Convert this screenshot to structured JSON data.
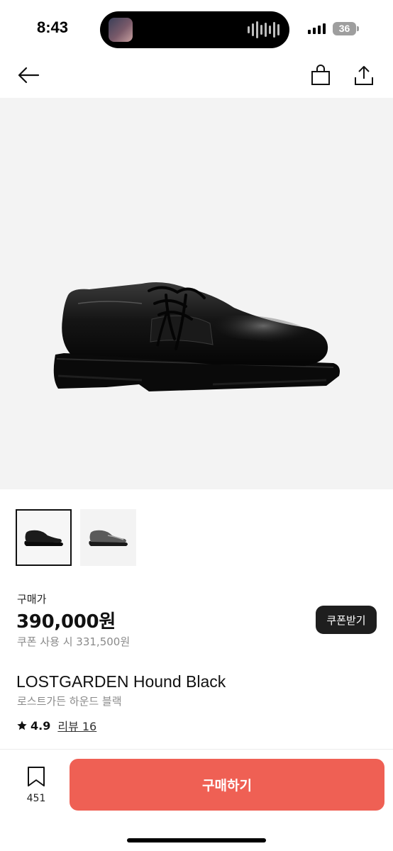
{
  "status_bar": {
    "time": "8:43",
    "battery": "36"
  },
  "icons": {
    "back": "back-arrow-icon",
    "bag": "shopping-bag-icon",
    "share": "share-icon",
    "wish": "bookmark-icon",
    "star": "star-icon"
  },
  "product": {
    "price_label": "구매가",
    "price": "390,000원",
    "coupon_price": "쿠폰 사용 시 331,500원",
    "coupon_button": "쿠폰받기",
    "name": "LOSTGARDEN Hound Black",
    "name_kr": "로스트가든 하운드 블랙",
    "rating": "4.9",
    "reviews": "리뷰 16"
  },
  "bottom_bar": {
    "wish_count": "451",
    "buy_label": "구매하기"
  },
  "colors": {
    "accent": "#ef6054",
    "coupon_button": "#1e1e1e",
    "hero_bg": "#f3f3f3"
  }
}
